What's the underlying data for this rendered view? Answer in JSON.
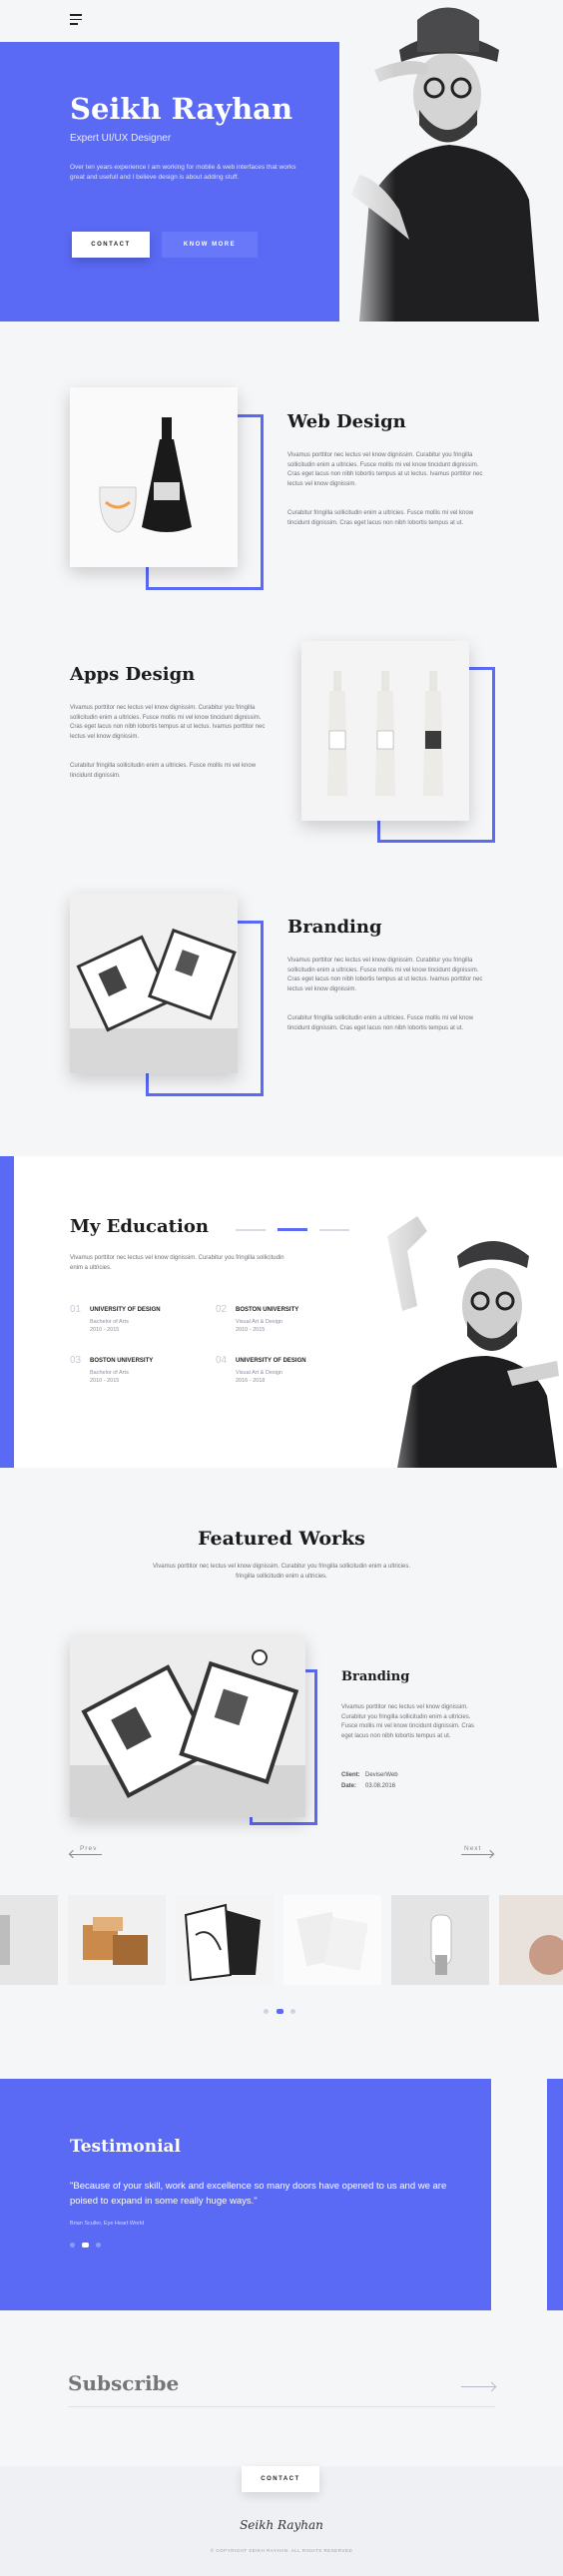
{
  "nav": {
    "menu_icon": "hamburger-icon"
  },
  "hero": {
    "name": "Seikh Rayhan",
    "role": "Expert UI/UX Designer",
    "bio": "Over ten years experience I am working for mobile & web interfaces that works great and usefull and I believe design is about adding stuff.",
    "contact_label": "CONTACT",
    "know_more_label": "KNOW MORE"
  },
  "services": [
    {
      "title": "Web Design",
      "p1": "Vivamus porttitor nec lectus vel know dignissim. Curabitur you fringilla sollicitudin enim a ultricies. Fusce mollis mi vel know tincidunt dignissim. Cras eget lacus non nibh lobortis tempus at ut lectus. Ivamus porttitor nec lectus vel know dignissim.",
      "p2": "Curabitur fringilla sollicitudin enim a ultricies. Fusce mollis mi vel know tincidunt dignissim. Cras eget lacus non nibh lobortis tempus at ut."
    },
    {
      "title": "Apps Design",
      "p1": "Vivamus porttitor nec lectus vel know dignissim. Curabitur you fringilla sollicitudin enim a ultricies. Fusce mollis mi vel know tincidunt dignissim. Cras eget lacus non nibh lobortis tempus at ut lectus. Ivamus porttitor nec lectus vel know dignissim.",
      "p2": "Curabitur fringilla sollicitudin enim a ultricies. Fusce mollis mi vel know tincidunt dignissim."
    },
    {
      "title": "Branding",
      "p1": "Vivamus porttitor nec lectus vel know dignissim. Curabitur you fringilla sollicitudin enim a ultricies. Fusce mollis mi vel know tincidunt dignissim. Cras eget lacus non nibh lobortis tempus at ut lectus. Ivamus porttitor nec lectus vel know dignissim.",
      "p2": "Curabitur fringilla sollicitudin enim a ultricies. Fusce mollis mi vel know tincidunt dignissim. Cras eget lacus non nibh lobortis tempus at ut."
    }
  ],
  "education": {
    "title": "My Education",
    "intro": "Vivamus porttitor nec lectus vel know dignissim. Curabitur you fringilla sollicitudin enim a ultricies.",
    "items": [
      {
        "num": "01",
        "school": "UNIVERSITY OF DESIGN",
        "degree": "Bachelor of Arts",
        "years": "2010 - 2015"
      },
      {
        "num": "02",
        "school": "BOSTON UNIVERSITY",
        "degree": "Visual Art & Design",
        "years": "2010 - 2015"
      },
      {
        "num": "03",
        "school": "BOSTON UNIVERSITY",
        "degree": "Bachelor of Arts",
        "years": "2010 - 2015"
      },
      {
        "num": "04",
        "school": "UNIVERSITY OF DESIGN",
        "degree": "Visual Art & Design",
        "years": "2016 - 2018"
      }
    ]
  },
  "works": {
    "title": "Featured Works",
    "intro": "Vivamus porttitor nec lectus vel know dignissim. Curabitur you fringilla sollicitudin enim a ultricies. fringilla sollicitudin enim a ultricies.",
    "item_title": "Branding",
    "item_desc": "Vivamus porttitor nec lectus vel know dignissim. Curabitur you fringilla sollicitudin enim a ultricies. Fusce mollis mi vel know tincidunt dignissim. Cras eget lacus non nibh lobortis tempus at ut.",
    "client_label": "Client:",
    "client_value": "DeviserWeb",
    "date_label": "Date:",
    "date_value": "03.08.2016",
    "prev_label": "Prev",
    "next_label": "Next"
  },
  "testimonial": {
    "title": "Testimonial",
    "quote": "\"Because of your skill, work and excellence so many doors have opened to us and we are poised to expand in some really huge ways.\"",
    "author": "Brian Sculler, Eye Heart World"
  },
  "subscribe": {
    "placeholder": "Subscribe"
  },
  "footer": {
    "contact_label": "CONTACT",
    "signature": "Seikh Rayhan",
    "copyright": "© COPYRIGHT SEIKH RAYHAN. ALL RIGHTS RESERVED"
  },
  "colors": {
    "accent": "#5a6af5",
    "background": "#f5f6f8"
  }
}
